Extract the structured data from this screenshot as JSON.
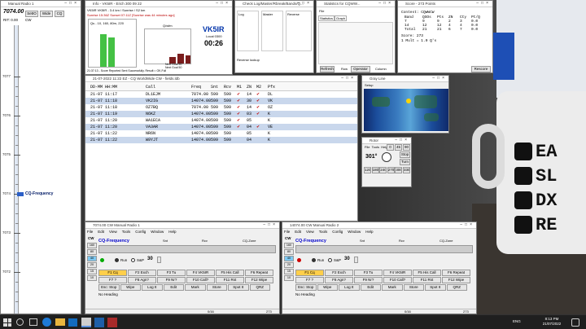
{
  "colors": {
    "accent": "#0000cc",
    "run_indicator": "#00aa00",
    "stop_indicator": "#cc0000",
    "selected_row": "#c9d7ec",
    "f1_highlight": "#ffcf4a",
    "webcam_bg": "#3a3a3a"
  },
  "radio_panel": {
    "title": "Manual Radio 1",
    "freq": "7074.00",
    "rit": "RIT: 0.00",
    "mode": "CW",
    "buttons": [
      "SetIO",
      "Wide",
      "CQ"
    ],
    "scale": [
      {
        "label": "7077",
        "cq": false
      },
      {
        "label": "7076",
        "cq": false
      },
      {
        "label": "7075",
        "cq": false
      },
      {
        "label": "7074",
        "cq": true
      },
      {
        "label": "7073",
        "cq": false
      },
      {
        "label": "7072",
        "cq": false
      }
    ],
    "cq_label": "CQ-Frequency"
  },
  "info_window": {
    "title": "Info - VK5IR - Erich 300 09 22",
    "line1": "VK5IR  VK5IR - 3.4 km / Sunrise / S2 km",
    "line2": "Sunrise 15:36Z Sunset 07:11Z [Sunrise was 44 minutes ago]",
    "header": "Qs - 10, 160, 80m, 220",
    "callsign": "VK5IR",
    "local": "Local 0300",
    "time": "00:26",
    "sub_label": "Q/wfm",
    "footer1": "Next Goal 50",
    "footer2": "Next Goal 50",
    "status": "21:37:13 - Score Reported Sent Successfully. Result = OK,Full"
  },
  "check_window": {
    "title": "Check Log/Master/Rbreak/Bands/Q...",
    "col_labels": [
      "Log",
      "Master",
      "Reverse"
    ],
    "footer": "Reverse lookup"
  },
  "stats_window": {
    "title": "Statistics for CQWW...",
    "menu": [
      "File"
    ],
    "tabs": [
      "Statistics",
      "Graph"
    ],
    "buttons": [
      "Refresh",
      "Row",
      "Operator",
      "Column"
    ]
  },
  "score_window": {
    "title": "Score - 273 Points",
    "contest": "Contest: CQWWCW",
    "headers": [
      "Band",
      "QSOs",
      "Pts",
      "ZN",
      "Cty",
      "Pt/Q"
    ],
    "rows": [
      [
        "7",
        "9",
        "9",
        "2",
        "3",
        "0.0"
      ],
      [
        "14",
        "12",
        "12",
        "4",
        "4",
        "0.0"
      ],
      [
        "Total",
        "21",
        "21",
        "6",
        "7",
        "0.0"
      ]
    ],
    "score_line": "Score: 273",
    "mult_line": "1 Mult = 1.0 Q's",
    "button": "Rescore"
  },
  "log_window": {
    "title": "21-07-2022 11:22 EZ - CQ WorldWide CW - fields.ldb",
    "headers": [
      "DD-MM HH:MM",
      "Call",
      "Freq",
      "Snt",
      "Rcv",
      "M1",
      "ZN",
      "M2",
      "Pfx"
    ],
    "rows": [
      {
        "dt": "21-07 11:17",
        "call": "DL1EJM",
        "freq": "7074.00",
        "snt": "599",
        "rcv": "599",
        "m1": "✔",
        "zn": "14",
        "m2": "✔",
        "pfx": "DL",
        "sel": false
      },
      {
        "dt": "21-07 11:18",
        "call": "VK2IG",
        "freq": "14074.00",
        "snt": "599",
        "rcv": "599",
        "m1": "✔",
        "zn": "30",
        "m2": "✔",
        "pfx": "VK",
        "sel": true
      },
      {
        "dt": "21-07 11:18",
        "call": "OZ7BQ",
        "freq": "7074.00",
        "snt": "599",
        "rcv": "599",
        "m1": "✔",
        "zn": "14",
        "m2": "✔",
        "pfx": "OZ",
        "sel": false
      },
      {
        "dt": "21-07 11:19",
        "call": "N6KZ",
        "freq": "14074.00",
        "snt": "599",
        "rcv": "599",
        "m1": "✔",
        "zn": "03",
        "m2": "✔",
        "pfx": "K",
        "sel": true
      },
      {
        "dt": "21-07 11:20",
        "call": "WA1ECA",
        "freq": "14074.00",
        "snt": "599",
        "rcv": "599",
        "m1": "✔",
        "zn": "05",
        "m2": "",
        "pfx": "K",
        "sel": false
      },
      {
        "dt": "21-07 11:20",
        "call": "VA3AR",
        "freq": "14074.00",
        "snt": "599",
        "rcv": "599",
        "m1": "✔",
        "zn": "04",
        "m2": "✔",
        "pfx": "VE",
        "sel": true
      },
      {
        "dt": "21-07 11:22",
        "call": "NR6N",
        "freq": "14074.00",
        "snt": "599",
        "rcv": "599",
        "m1": "",
        "zn": "05",
        "m2": "",
        "pfx": "K",
        "sel": false
      },
      {
        "dt": "21-07 11:22",
        "call": "W9YJT",
        "freq": "14074.00",
        "snt": "599",
        "rcv": "599",
        "m1": "",
        "zn": "04",
        "m2": "",
        "pfx": "K",
        "sel": true
      }
    ]
  },
  "grayline": {
    "title": "Gray Line",
    "menu": "Setup"
  },
  "rotor": {
    "title": "Rotor",
    "menu": [
      "File",
      "Tools",
      "Help"
    ],
    "heading": "301°",
    "stop": "Stop",
    "turn": "Turn",
    "presets": [
      "0",
      "45",
      "90",
      "120",
      "180",
      "240",
      "270",
      "300",
      "330"
    ]
  },
  "cw_windows": [
    {
      "title": "7074.00 CW Manual Radio 1",
      "mode": "CW",
      "status_badge": "Run"
    },
    {
      "title": "14074.00 CW Manual Radio 2",
      "mode": "CW",
      "status_badge": "Run"
    }
  ],
  "cw_common": {
    "menu": [
      "File",
      "Edit",
      "View",
      "Tools",
      "Config",
      "Window",
      "Help"
    ],
    "bands": [
      "160",
      "80",
      "40",
      "20",
      "15",
      "10"
    ],
    "cq_freq": "CQ-Frequency",
    "col_labels": [
      "Snt",
      "Rcv",
      "CQ-Zone"
    ],
    "run": "Run",
    "sp": "S&P",
    "speed": "30",
    "fkeys": [
      [
        "F1 Cq",
        "F2 Exch",
        "F3 Tu",
        "F4 VK5IR",
        "F5 His Call",
        "F6 Repeat"
      ],
      [
        "F7 ?",
        "F8 Agn?",
        "F9 Nr?",
        "F10 Call?",
        "F11 Rst",
        "F12 Wipe"
      ],
      [
        "Esc: Stop",
        "Wipe",
        "Log It",
        "Edit",
        "Mark",
        "Store",
        "Spot It",
        "QRZ"
      ]
    ],
    "no_heading": "No Heading",
    "footer_mid": "0/16",
    "footer_right": "273"
  },
  "mug": {
    "rows": [
      "EA",
      "SL",
      "DX",
      "RE"
    ]
  },
  "taskbar": {
    "time": "8:13 PM",
    "date": "21/07/2022",
    "lang": "ENG"
  }
}
